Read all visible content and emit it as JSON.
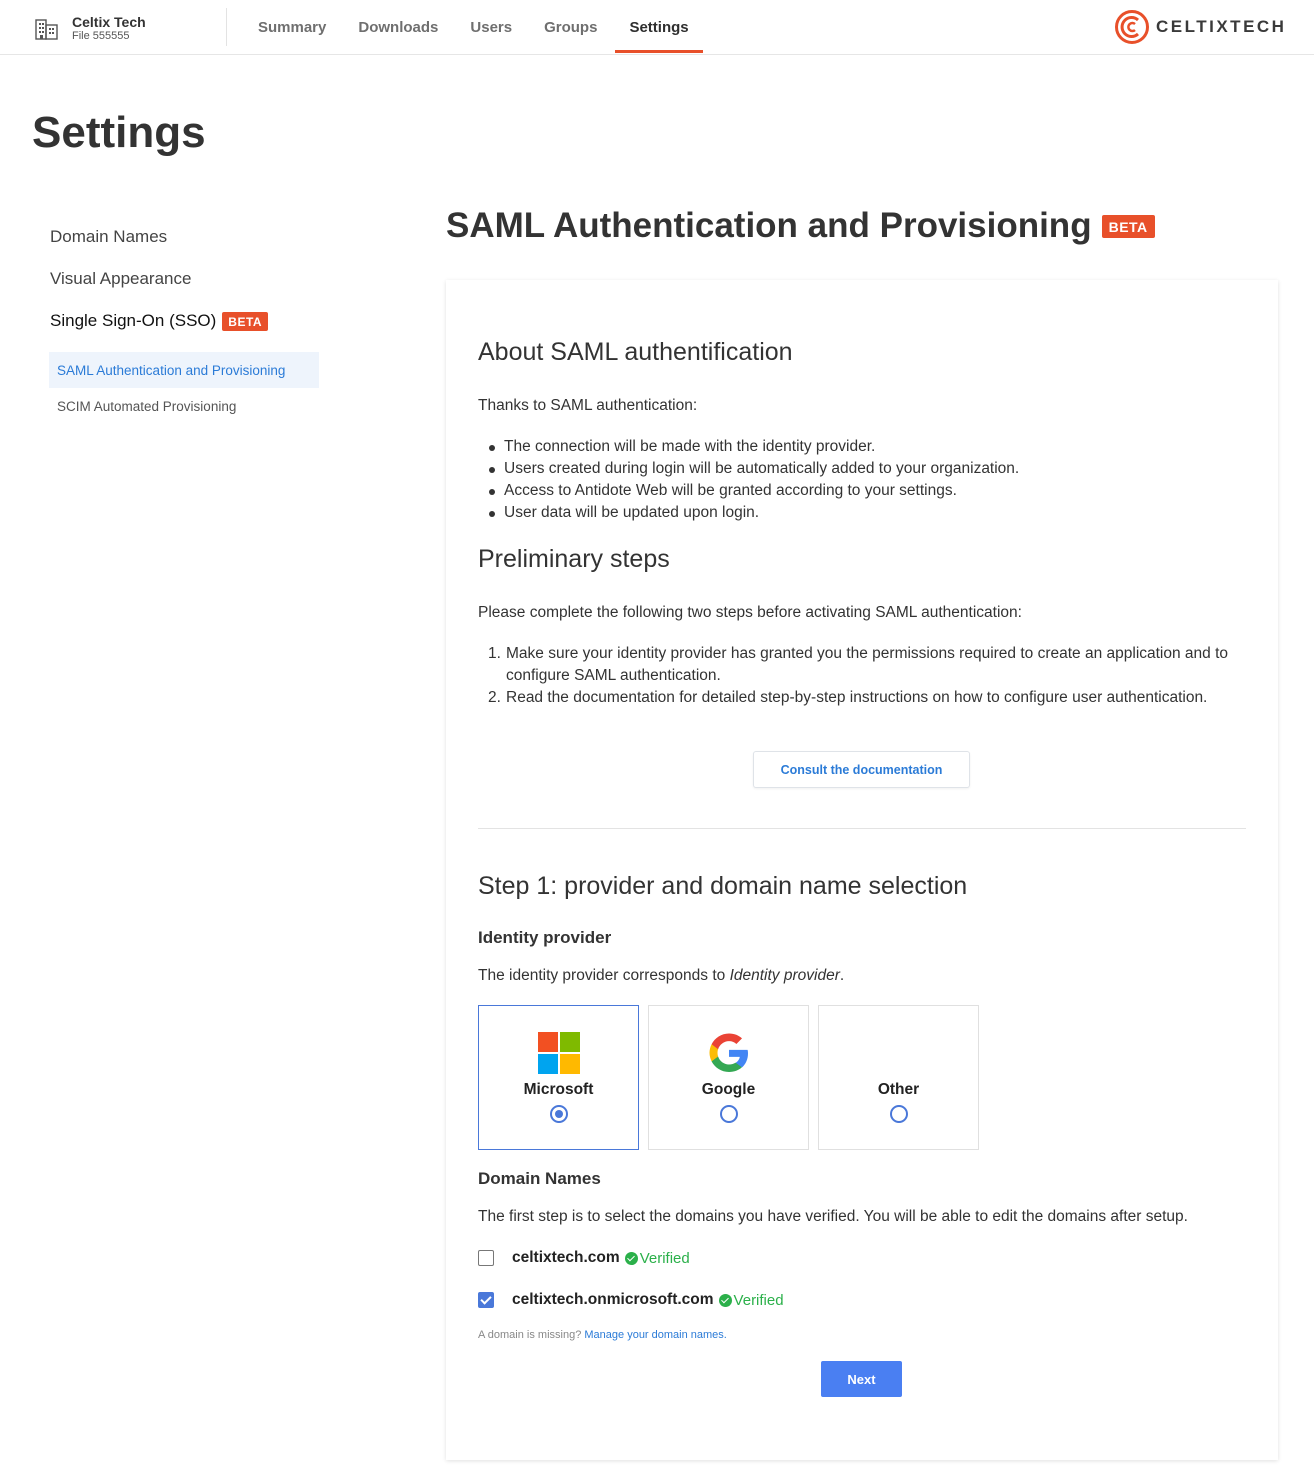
{
  "org": {
    "name": "Celtix Tech",
    "file": "File 555555"
  },
  "nav": {
    "items": [
      "Summary",
      "Downloads",
      "Users",
      "Groups",
      "Settings"
    ],
    "active": "Settings"
  },
  "brand": {
    "text": "CELTIXTECH",
    "color": "#e8502a"
  },
  "page_title": "Settings",
  "sidebar": {
    "items": [
      {
        "label": "Domain Names"
      },
      {
        "label": "Visual Appearance"
      },
      {
        "label": "Single Sign-On (SSO)",
        "badge": "BETA"
      }
    ],
    "sub_items": [
      {
        "label": "SAML Authentication and Provisioning",
        "active": true
      },
      {
        "label": "SCIM Automated Provisioning",
        "active": false
      }
    ]
  },
  "main": {
    "title": "SAML Authentication and Provisioning",
    "badge": "BETA",
    "about": {
      "heading": "About SAML authentification",
      "intro": "Thanks to SAML authentication:",
      "bullets": [
        "The connection will be made with the identity provider.",
        "Users created during login will be automatically added to your organization.",
        "Access to Antidote Web will be granted according to your settings.",
        "User data will be updated upon login."
      ]
    },
    "preliminary": {
      "heading": "Preliminary steps",
      "intro": "Please complete the following two steps before activating SAML authentication:",
      "steps": [
        {
          "num": "1.",
          "text": "Make sure your identity provider has granted you the permissions required to create an application and to configure SAML authentication."
        },
        {
          "num": "2.",
          "text": "Read the documentation for detailed step-by-step instructions on how to configure user authentication."
        }
      ],
      "doc_button": "Consult the documentation"
    },
    "step1": {
      "heading": "Step 1: provider and domain name selection",
      "identity_heading": "Identity provider",
      "identity_desc_prefix": "The identity provider corresponds to ",
      "identity_desc_em": "Identity provider",
      "identity_desc_suffix": ".",
      "providers": [
        {
          "name": "Microsoft",
          "icon": "microsoft-icon",
          "selected": true
        },
        {
          "name": "Google",
          "icon": "google-icon",
          "selected": false
        },
        {
          "name": "Other",
          "icon": "",
          "selected": false
        }
      ],
      "domains_heading": "Domain Names",
      "domains_desc": "The first step is to select the domains you have verified. You will be able to edit the domains after setup.",
      "domains": [
        {
          "name": "celtixtech.com",
          "status": "Verified",
          "checked": false
        },
        {
          "name": "celtixtech.onmicrosoft.com",
          "status": "Verified",
          "checked": true
        }
      ],
      "missing_text": "A domain is missing?",
      "missing_link": "Manage your domain names.",
      "next_button": "Next"
    }
  },
  "colors": {
    "accent": "#e8502a",
    "primary": "#4a7ff2",
    "link": "#2b7bd7",
    "verified": "#2bb04a"
  }
}
